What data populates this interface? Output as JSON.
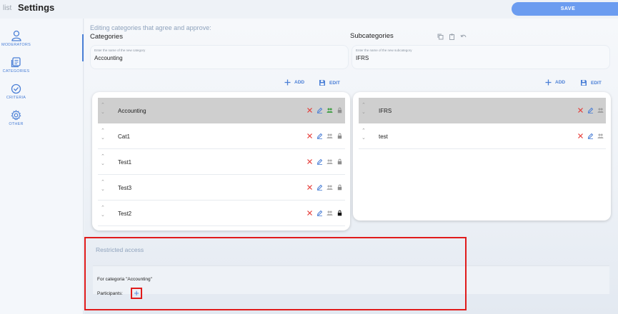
{
  "topbar": {
    "breadcrumb": "list",
    "title": "Settings",
    "save_label": "SAVE"
  },
  "sidebar": {
    "items": [
      {
        "label": "MODERATORS",
        "icon": "person-icon"
      },
      {
        "label": "CATEGORIES",
        "icon": "document-stack-icon"
      },
      {
        "label": "CRITERIA",
        "icon": "check-circle-icon"
      },
      {
        "label": "OTHER",
        "icon": "gear-icon"
      }
    ],
    "active": "CATEGORIES"
  },
  "main": {
    "header": "Editing categories that agree and approve:",
    "categories": {
      "title": "Categories",
      "placeholder": "Enter the name of the new category",
      "value": "Accounting",
      "add_label": "ADD",
      "edit_label": "EDIT",
      "items": [
        "Accounting",
        "Cat1",
        "Test1",
        "Test3",
        "Test2"
      ]
    },
    "subcategories": {
      "title": "Subcategories",
      "placeholder": "Enter the name of the new subcategory",
      "value": "IFRS",
      "add_label": "ADD",
      "edit_label": "EDIT",
      "items": [
        "IFRS",
        "test"
      ]
    }
  },
  "restricted": {
    "title": "Restricted access",
    "for_text": "For categoria \"Accounting\"",
    "participants_label": "Participants:",
    "add_symbol": "+"
  },
  "colors": {
    "accent": "#4a7fd6",
    "save": "#6b9cf0",
    "delete": "#e53935",
    "highlight": "#e01b1b",
    "selected_row": "#cfcfcf",
    "group_active": "#43a047"
  }
}
